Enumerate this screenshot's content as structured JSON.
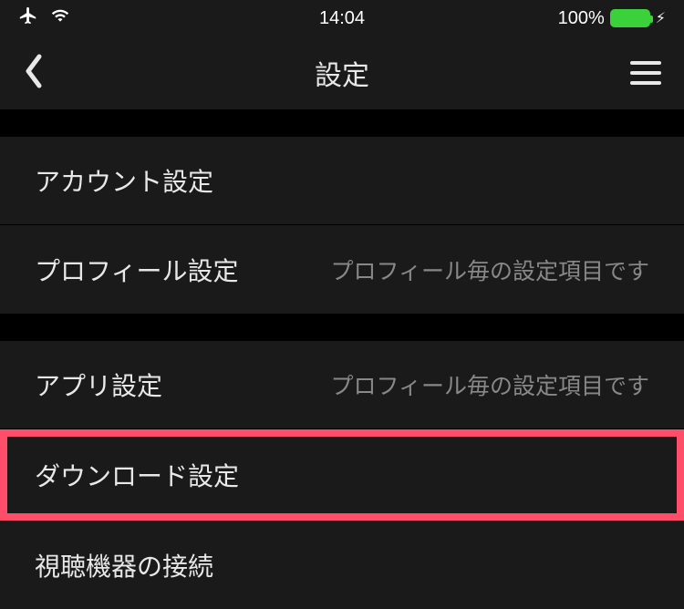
{
  "status": {
    "time": "14:04",
    "battery_text": "100%"
  },
  "nav": {
    "title": "設定"
  },
  "sections": [
    {
      "items": [
        {
          "label": "アカウント設定",
          "sub": ""
        },
        {
          "label": "プロフィール設定",
          "sub": "プロフィール毎の設定項目です"
        }
      ]
    },
    {
      "items": [
        {
          "label": "アプリ設定",
          "sub": "プロフィール毎の設定項目です"
        },
        {
          "label": "ダウンロード設定",
          "sub": "",
          "highlighted": true
        },
        {
          "label": "視聴機器の接続",
          "sub": ""
        }
      ]
    }
  ]
}
